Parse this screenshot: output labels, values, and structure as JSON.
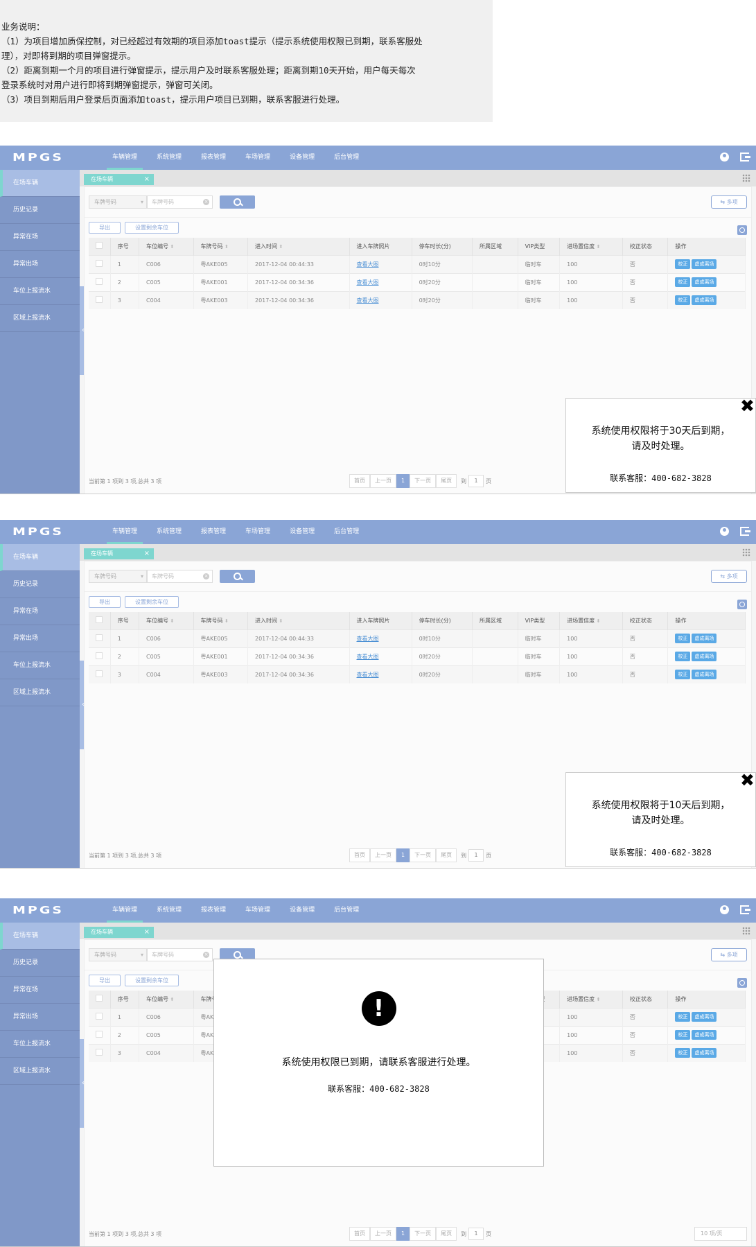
{
  "note": {
    "lines": [
      "业务说明：",
      "（1）为项目增加质保控制，对已经超过有效期的项目添加toast提示（提示系统使用权限已到期，联系客服处",
      "理），对即将到期的项目弹窗提示。",
      "（2）距离到期一个月的项目进行弹窗提示，提示用户及时联系客服处理；距离到期10天开始，用户每天每次",
      "登录系统时对用户进行即将到期弹窗提示，弹窗可关闭。",
      "（3）项目到期后用户登录后页面添加toast，提示用户项目已到期，联系客服进行处理。"
    ]
  },
  "app": {
    "logo": "MPGS",
    "nav": [
      "车辆管理",
      "系统管理",
      "报表管理",
      "车场管理",
      "设备管理",
      "后台管理"
    ],
    "sidebar": [
      "在场车辆",
      "历史记录",
      "异常在场",
      "异常出场",
      "车位上报流水",
      "区域上报流水"
    ],
    "tab_label": "在场车辆",
    "tab_close": "×",
    "filter_select": "车牌号码",
    "filter_placeholder": "车牌号码",
    "more_button": "⇆ 多项",
    "export_button": "导出",
    "remaining_button": "设置剩余车位",
    "columns": [
      "",
      "序号",
      "车位编号",
      "车牌号码",
      "进入时间",
      "进入车牌照片",
      "停车时长(分)",
      "所属区域",
      "VIP类型",
      "进场置信度",
      "校正状态",
      "操作"
    ],
    "rows": [
      {
        "no": "1",
        "slot": "C006",
        "plate": "粤AKE005",
        "time": "2017-12-04 00:44:33",
        "photo": "查看大图",
        "duration": "0时10分",
        "area": "",
        "vip": "临时车",
        "conf": "100",
        "status": "否"
      },
      {
        "no": "2",
        "slot": "C005",
        "plate": "粤AKE001",
        "time": "2017-12-04 00:34:36",
        "photo": "查看大图",
        "duration": "0时20分",
        "area": "",
        "vip": "临时车",
        "conf": "100",
        "status": "否"
      },
      {
        "no": "3",
        "slot": "C004",
        "plate": "粤AKE003",
        "time": "2017-12-04 00:34:36",
        "photo": "查看大图",
        "duration": "0时20分",
        "area": "",
        "vip": "临时车",
        "conf": "100",
        "status": "否"
      }
    ],
    "op_correct": "校正",
    "op_exit": "虚成离场",
    "footer_text": "当前第 1 项到 3 项,总共 3 项",
    "pager": [
      "首页",
      "上一页",
      "1",
      "下一页",
      "尾页"
    ],
    "goto_prefix": "到",
    "goto_value": "1",
    "goto_suffix": "页",
    "per_page": "10 项/页"
  },
  "toast_30": {
    "message_1": "系统使用权限将于30天后到期，",
    "message_2": "请及时处理。",
    "service": "联系客服：400-682-3828",
    "close": "✖"
  },
  "toast_10": {
    "message_1": "系统使用权限将于10天后到期，",
    "message_2": "请及时处理。",
    "service": "联系客服：400-682-3828",
    "close": "✖"
  },
  "modal": {
    "icon": "!",
    "message": "系统使用权限已到期，请联系客服进行处理。",
    "service": "联系客服：400-682-3828"
  }
}
